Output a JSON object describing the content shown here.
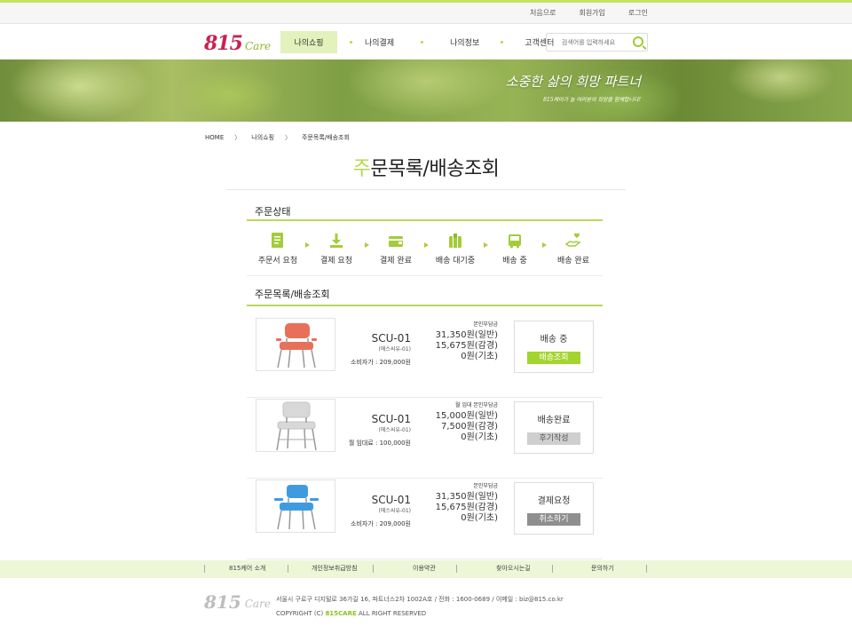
{
  "util_links": [
    "처음으로",
    "회원가입",
    "로그인"
  ],
  "logo": {
    "num": "815",
    "care": "Care"
  },
  "menu": [
    "나의쇼핑",
    "나의결제",
    "나의정보",
    "고객센터"
  ],
  "search": {
    "placeholder": "검색어를 입력하세요"
  },
  "banner": {
    "main": "소중한 삶의 희망 파트너",
    "sub": "815케어가 늘 여러분의 희망을 함께합니다!"
  },
  "breadcrumb": [
    "HOME",
    "나의쇼핑",
    "주문목록/배송조회"
  ],
  "page_title": {
    "first": "주",
    "rest": "문목록/배송조회"
  },
  "order_status_title": "주문상태",
  "steps": [
    "주문서 요청",
    "결제 요청",
    "결제 완료",
    "배송 대기중",
    "배송 중",
    "배송 완료"
  ],
  "order_list_title": "주문목록/배송조회",
  "orders": [
    {
      "code": "SCU-01",
      "kor": "(에스씨유-01)",
      "price_label": "소비자가 : 209,000원",
      "pay_head": "본인부담금",
      "pay": [
        "31,350원(일반)",
        "15,675원(감경)",
        "0원(기초)"
      ],
      "status": "배송 중",
      "button": "배송조회",
      "color": "#e87058"
    },
    {
      "code": "SCU-01",
      "kor": "(에스씨유-01)",
      "price_label": "월 임대료 : 100,000원",
      "pay_head": "월 임대 본인부담금",
      "pay": [
        "15,000원(일반)",
        "7,500원(감경)",
        "0원(기초)"
      ],
      "status": "배송완료",
      "button": "후기작성",
      "color": "#d8d8d8"
    },
    {
      "code": "SCU-01",
      "kor": "(에스씨유-01)",
      "price_label": "소비자가 : 209,000원",
      "pay_head": "본인부담금",
      "pay": [
        "31,350원(일반)",
        "15,675원(감경)",
        "0원(기초)"
      ],
      "status": "결제요청",
      "button": "취소하기",
      "color": "#3f9be0"
    }
  ],
  "footer_nav": [
    "815케어 소개",
    "개인정보취급방침",
    "이용약관",
    "찾아오시는길",
    "문의하기"
  ],
  "footer": {
    "address": "서울시 구로구 디지털로 36가길 16, 파트너스2차 1002A호 / 전화 : 1600-0689 / 이메일 : biz@815.co.kr",
    "copy_prefix": "COPYRIGHT  (C) ",
    "copy_brand": "815CARE",
    "copy_suffix": " ALL RIGHT RESERVED"
  },
  "colors": {
    "accent": "#b7d94a",
    "brand_red": "#c8234f",
    "button_green": "#a3d52e"
  }
}
